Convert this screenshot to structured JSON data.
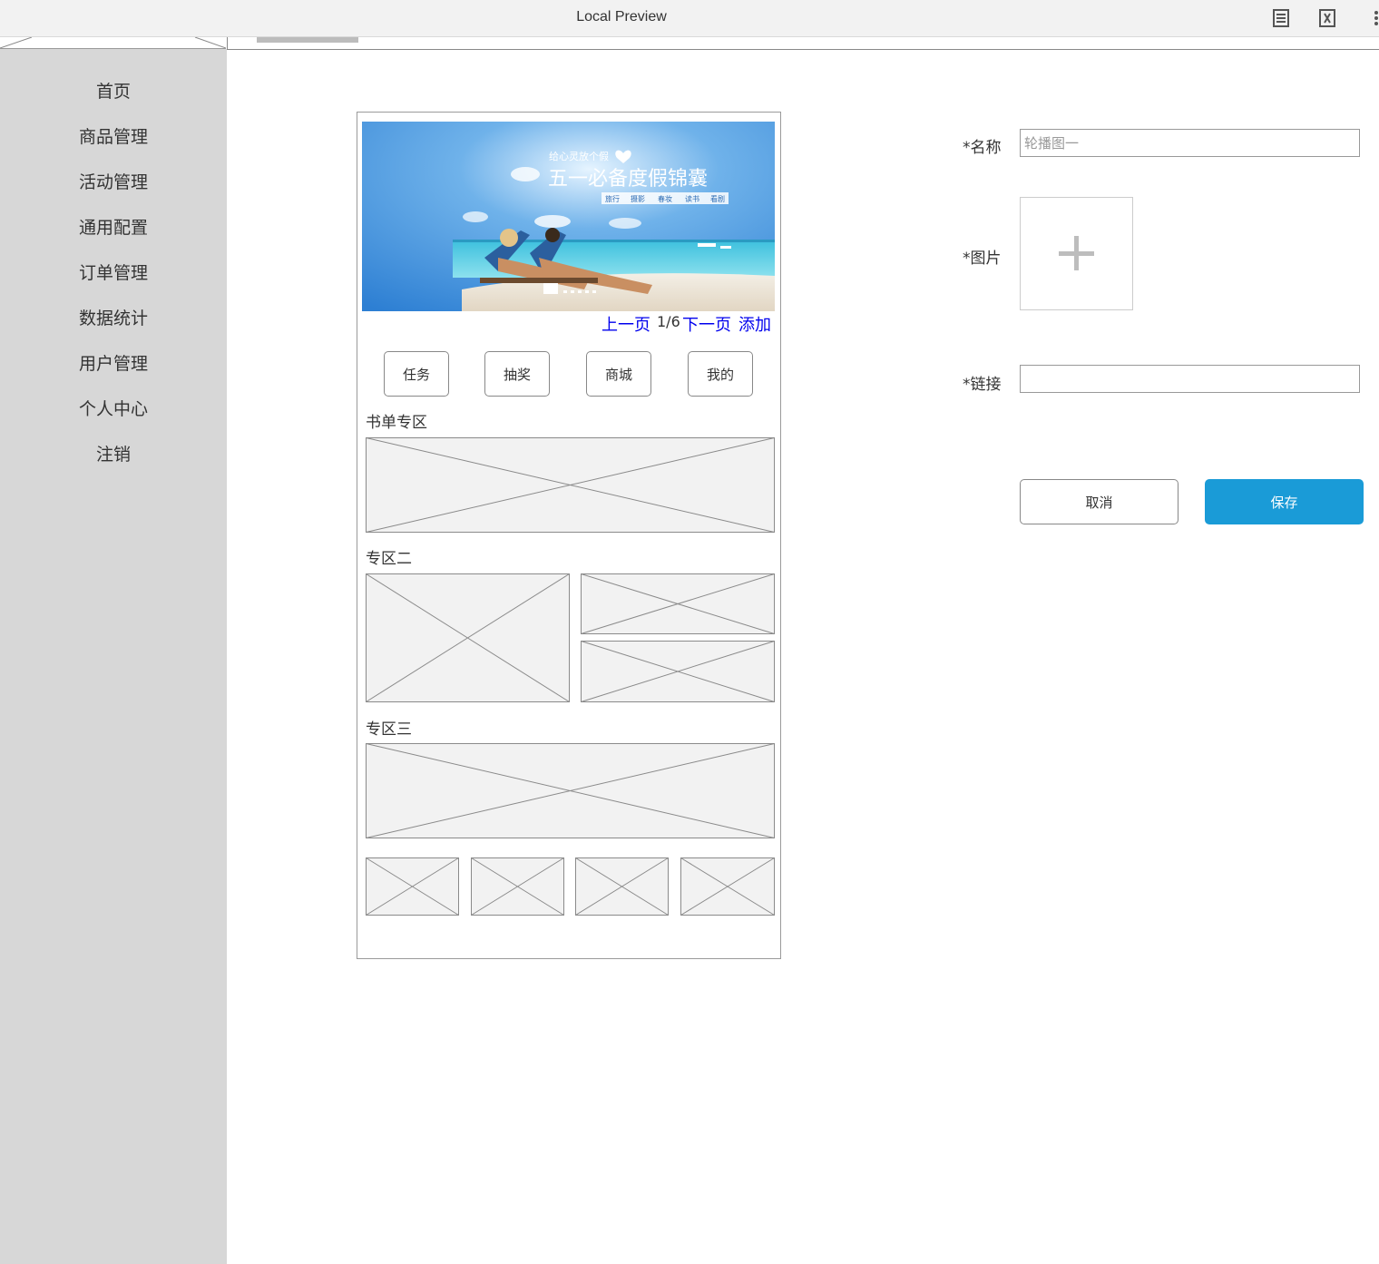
{
  "window": {
    "title": "Local Preview"
  },
  "sidebar": {
    "items": [
      {
        "label": "首页"
      },
      {
        "label": "商品管理"
      },
      {
        "label": "活动管理"
      },
      {
        "label": "通用配置"
      },
      {
        "label": "订单管理"
      },
      {
        "label": "数据统计"
      },
      {
        "label": "用户管理"
      },
      {
        "label": "个人中心"
      },
      {
        "label": "注销"
      }
    ]
  },
  "preview": {
    "banner": {
      "tagline": "给心灵放个假",
      "headline": "五一必备度假锦囊",
      "tags": [
        "旅行",
        "摄影",
        "春妆",
        "读书",
        "看剧"
      ]
    },
    "pager": {
      "prev": "上一页",
      "count": "1/6",
      "next": "下一页",
      "add": "添加"
    },
    "quick_buttons": [
      "任务",
      "抽奖",
      "商城",
      "我的"
    ],
    "sections": {
      "books": "书单专区",
      "zone2": "专区二",
      "zone3": "专区三"
    }
  },
  "form": {
    "name_label": "*名称",
    "name_placeholder": "轮播图一",
    "image_label": "*图片",
    "link_label": "*链接",
    "link_value": "",
    "cancel_label": "取消",
    "save_label": "保存"
  },
  "colors": {
    "sidebar_bg": "#d7d7d7",
    "link": "#0000ee",
    "save_button": "#1a9bd7"
  }
}
